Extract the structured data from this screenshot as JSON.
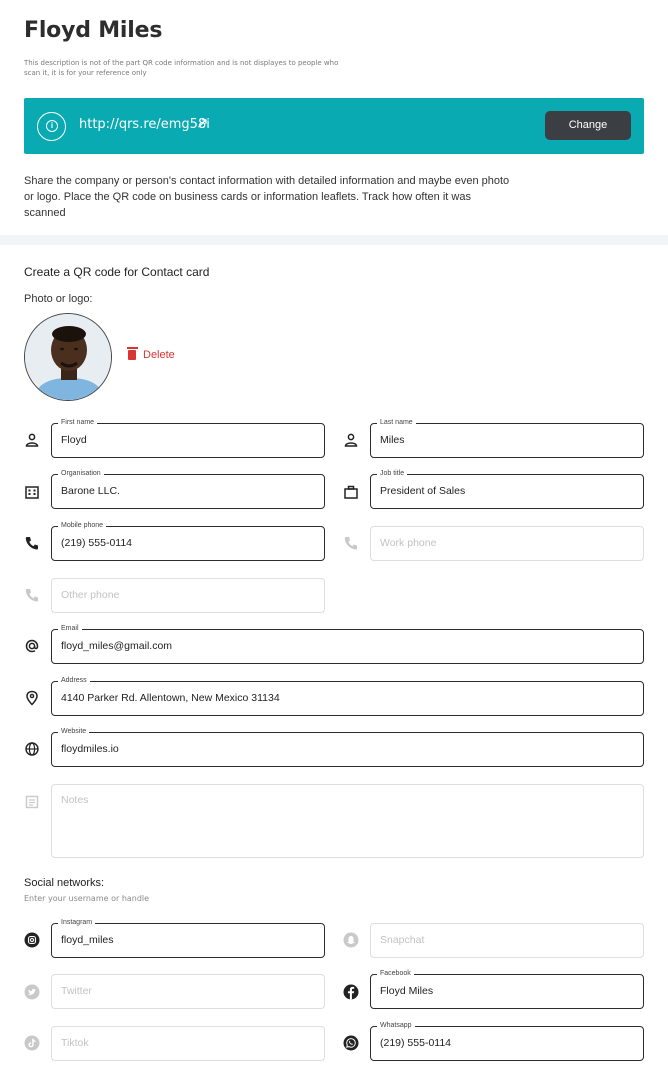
{
  "page": {
    "title": "Floyd Miles",
    "description": "This description is not of the part QR code information and is not displayes to people who scan it, it is for your reference only"
  },
  "banner": {
    "url": "http://qrs.re/emg58i",
    "change_label": "Change",
    "bg_color": "#0aaab3"
  },
  "lead_text": "Share the company or person's contact information with detailed information and maybe even photo or logo. Place the QR code on business cards or information leaflets. Track how often it was scanned",
  "form": {
    "section_title": "Create a QR code for Contact card",
    "photo_label": "Photo or logo:",
    "delete_label": "Delete",
    "first_name": {
      "label": "First name",
      "value": "Floyd"
    },
    "last_name": {
      "label": "Last name",
      "value": "Miles"
    },
    "organisation": {
      "label": "Organisation",
      "value": "Barone LLC."
    },
    "job_title": {
      "label": "Job title",
      "value": "President of Sales"
    },
    "mobile_phone": {
      "label": "Mobile phone",
      "value": "(219) 555-0114"
    },
    "work_phone": {
      "placeholder": "Work phone"
    },
    "other_phone": {
      "placeholder": "Other phone"
    },
    "email": {
      "label": "Email",
      "value": "floyd_miles@gmail.com"
    },
    "address": {
      "label": "Address",
      "value": "4140 Parker Rd. Allentown, New Mexico 31134"
    },
    "website": {
      "label": "Website",
      "value": "floydmiles.io"
    },
    "notes": {
      "placeholder": "Notes"
    }
  },
  "social": {
    "title": "Social networks:",
    "subtitle": "Enter your username or handle",
    "instagram": {
      "label": "Instagram",
      "value": "floyd_miles"
    },
    "snapchat": {
      "placeholder": "Snapchat"
    },
    "twitter": {
      "placeholder": "Twitter"
    },
    "facebook": {
      "label": "Facebook",
      "value": "Floyd Miles"
    },
    "tiktok": {
      "placeholder": "Tiktok"
    },
    "whatsapp": {
      "label": "Whatsapp",
      "value": "(219) 555-0114"
    }
  },
  "icons": [
    "info-icon",
    "external-link-icon",
    "trash-icon",
    "person-icon",
    "building-icon",
    "briefcase-icon",
    "phone-icon",
    "at-icon",
    "location-icon",
    "globe-icon",
    "notes-icon",
    "instagram-icon",
    "snapchat-icon",
    "twitter-icon",
    "facebook-icon",
    "tiktok-icon",
    "whatsapp-icon"
  ],
  "colors": {
    "accent": "#0aaab3",
    "danger": "#d93434",
    "button_dark": "#3b3f44"
  }
}
